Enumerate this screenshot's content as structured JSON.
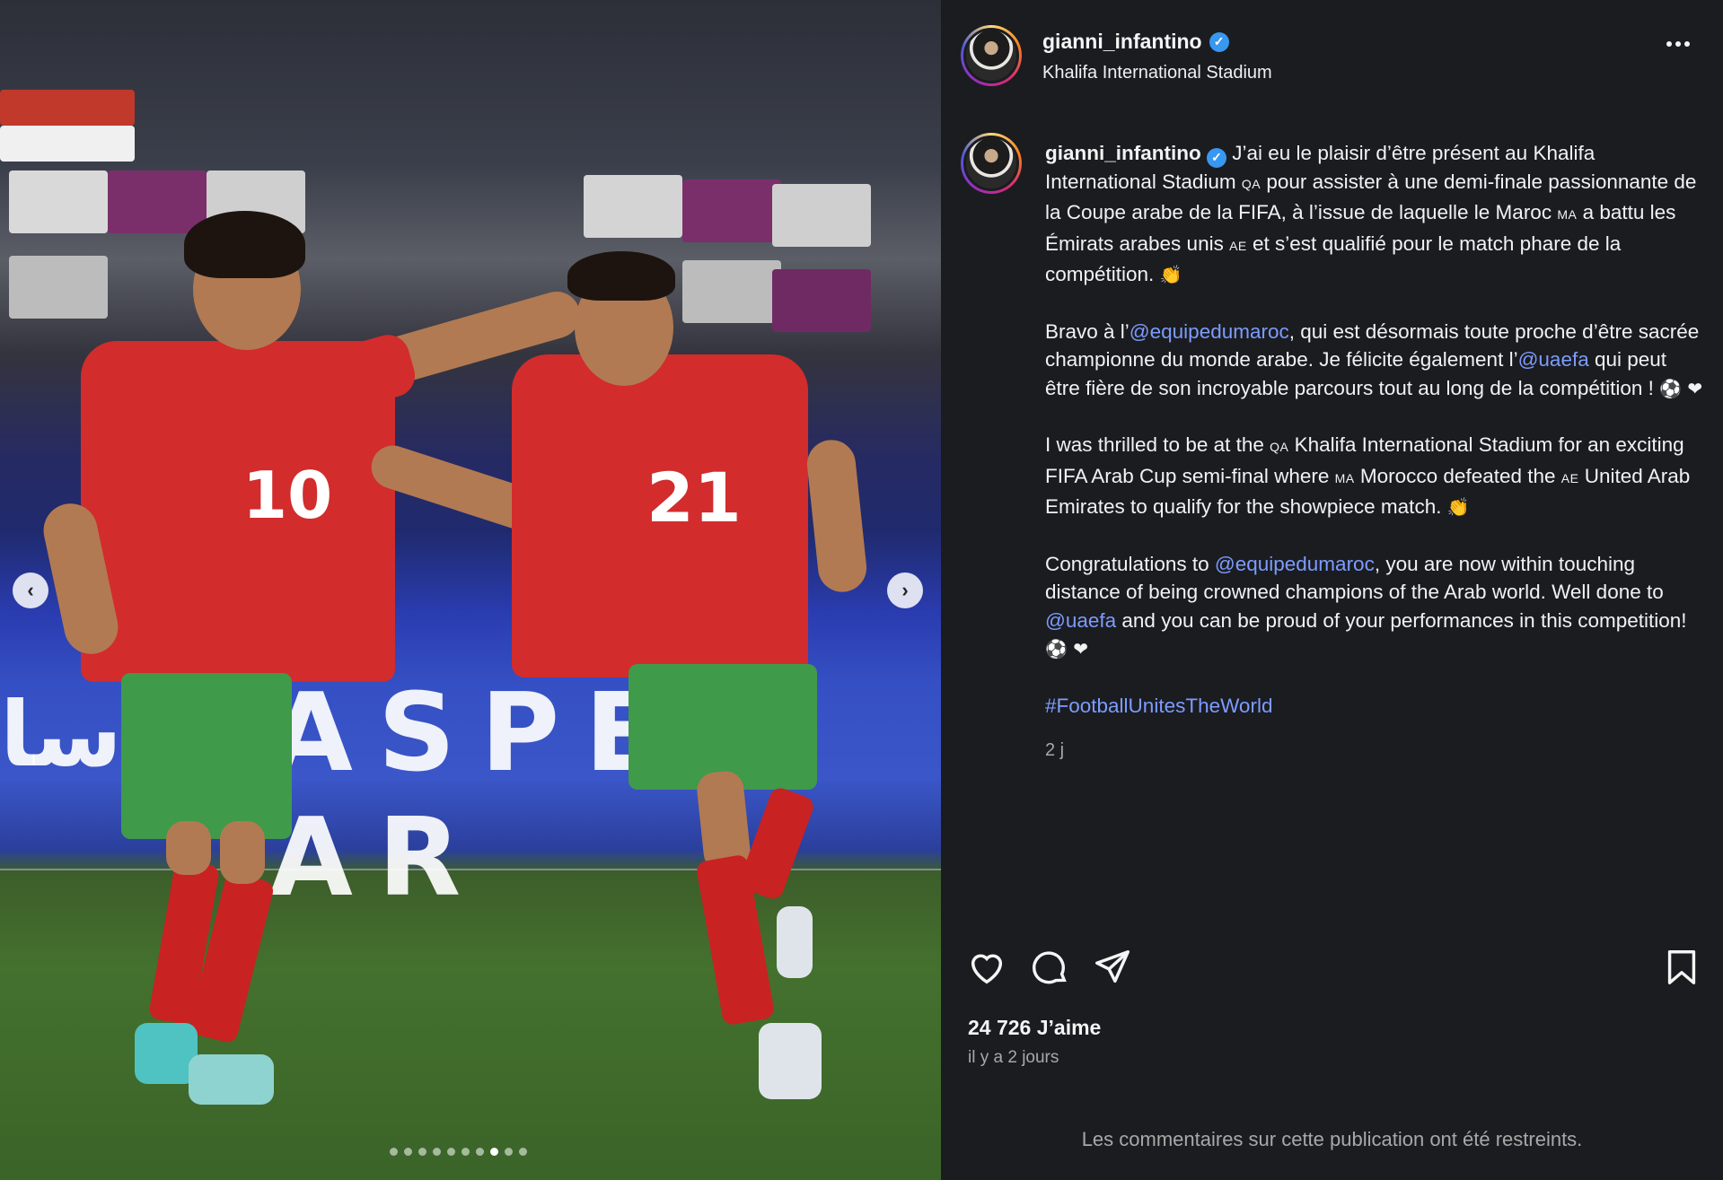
{
  "post": {
    "username": "gianni_infantino",
    "verified_icon": "✓",
    "location": "Khalifa International Stadium",
    "caption": {
      "p1_a": " J’ai eu le plaisir d’être présent au Khalifa International Stadium ",
      "p1_flag1": "QA",
      "p1_b": " pour assister à une demi-finale passionnante de la Coupe arabe de la FIFA, à l’issue de laquelle le Maroc ",
      "p1_flag2": "MA",
      "p1_c": " a battu les Émirats arabes unis ",
      "p1_flag3": "AE",
      "p1_d": " et s’est qualifié pour le match phare de la compétition. ",
      "p1_emoji": "👏",
      "p2_a": "Bravo à l’",
      "p2_mention1": "@equipedumaroc",
      "p2_b": ", qui est désormais toute proche d’être sacrée championne du monde arabe. Je félicite également l’",
      "p2_mention2": "@uaefa",
      "p2_c": " qui peut être fière de son incroyable parcours tout au long de la compétition ! ",
      "p2_emoji": "⚽ ❤",
      "p3_a": "I was thrilled to be at the ",
      "p3_flag1": "QA",
      "p3_b": " Khalifa International Stadium for an exciting FIFA Arab Cup semi-final where ",
      "p3_flag2": "MA",
      "p3_c": " Morocco defeated the ",
      "p3_flag3": "AE",
      "p3_d": " United Arab Emirates to qualify for the showpiece match. ",
      "p3_emoji": "👏",
      "p4_a": "Congratulations to ",
      "p4_mention1": "@equipedumaroc",
      "p4_b": ", you are now within touching distance of being crowned champions of the Arab world. Well done to ",
      "p4_mention2": "@uaefa",
      "p4_c": " and you can be proud of your performances in this competition! ",
      "p4_emoji": "⚽ ❤",
      "hashtag": "#FootballUnitesTheWorld",
      "time": "2 j"
    },
    "likes": "24 726 J’aime",
    "date": "il y a 2 jours",
    "comments_restricted": "Les commentaires sur cette publication ont été restreints."
  },
  "media": {
    "board_text": "ASPE AR",
    "board_arabic": "سا",
    "player_numbers": [
      "10",
      "21"
    ],
    "carousel": {
      "total": 10,
      "active": 7
    },
    "prev_icon": "‹",
    "next_icon": "›"
  },
  "colors": {
    "panel_bg": "#1b1c20",
    "link": "#7c9cff",
    "muted": "#a8a8a8",
    "verified": "#3897f0"
  },
  "icons": [
    "heart-icon",
    "comment-icon",
    "share-icon",
    "bookmark-icon",
    "more-icon",
    "verified-icon",
    "chevron-left-icon",
    "chevron-right-icon"
  ]
}
